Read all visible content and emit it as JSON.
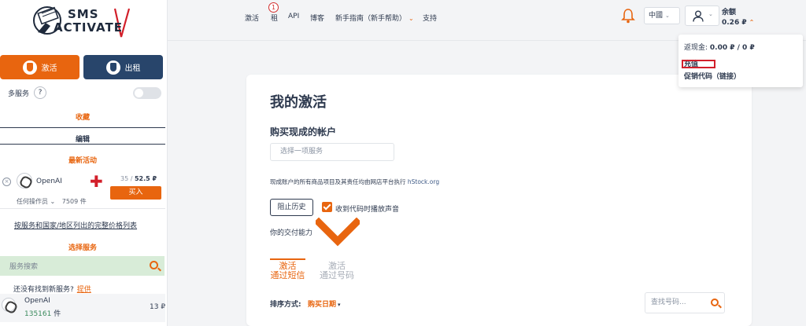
{
  "brand": {
    "line1": "SMS",
    "line2": "ACTIVATE"
  },
  "sidebar": {
    "activate_label": "激活",
    "rent_label": "出租",
    "multi_service_label": "多服务",
    "help_glyph": "?",
    "favorites_label": "收藏",
    "edit_label": "编辑",
    "promo_label": "最新活动",
    "promo_item": {
      "close_glyph": "×",
      "name": "OpenAI",
      "cross_glyph": "✚",
      "price_prefix": "35 / ",
      "price_value": "52.5 ₽",
      "buy_label": "买入",
      "operator_label": "任何操作员 ⌄",
      "count": "7509 件"
    },
    "price_list_link": "按服务和国家/地区列出的完整价格列表",
    "choose_service_label": "选择服务",
    "service_search_placeholder": "服务搜索",
    "not_found_text": "还没有找到新服务?",
    "not_found_link": "提供",
    "service_row": {
      "name": "OpenAI",
      "count_num": "135161",
      "count_unit": " 件",
      "price": "13 ₽"
    }
  },
  "topnav": {
    "items": [
      "激活",
      "租",
      "API",
      "博客",
      "新手指南（新手帮助）",
      "支持"
    ],
    "badge_count": "1",
    "language": "中國",
    "balance_label": "余额",
    "balance_value": "0.26 ₽"
  },
  "dropdown": {
    "cashback_prefix": "返现金: ",
    "cashback_value": "0.00 ₽ / 0 ₽",
    "topup_label": "充值",
    "promo_code_label": "促销代码（链接）"
  },
  "main": {
    "title": "我的激活",
    "buy_ready_title": "购买现成的帐户",
    "select_service_placeholder": "选择一项服务",
    "info_text": "现成账户的所有商品项目及其责任均由网店平台执行",
    "info_link": "hStock.org",
    "block_history_label": "阻止历史",
    "sound_checkbox_label": "收到代码时播放声音",
    "delivery_label": "你的交付能力",
    "tabs": [
      {
        "line1": "激活",
        "line2": "通过短信"
      },
      {
        "line1": "激活",
        "line2": "通过号码"
      }
    ],
    "sort_label": "排序方式:",
    "sort_value": "购买日期",
    "number_search_placeholder": "查找号码..."
  },
  "colors": {
    "accent": "#e8650f",
    "navy": "#28456b",
    "text": "#2e3a4f",
    "highlight_box": "#d21f2a"
  }
}
